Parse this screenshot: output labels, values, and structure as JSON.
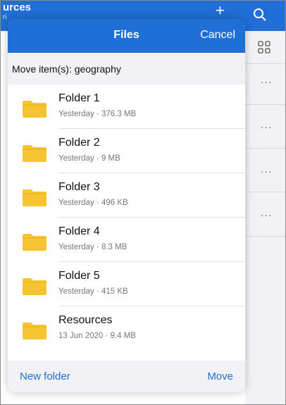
{
  "background": {
    "title": "urces",
    "subtitle": "ri",
    "plus_icon": "plus-icon",
    "search_icon": "search-icon",
    "grid_icon": "grid-view-icon",
    "more_icon": "more-icon",
    "more_label": "···"
  },
  "sheet": {
    "title": "Files",
    "cancel_label": "Cancel",
    "move_label_prefix": "Move item(s): ",
    "move_item_name": "geography",
    "items": [
      {
        "name": "Folder 1",
        "meta": "Yesterday · 376.3 MB"
      },
      {
        "name": "Folder 2",
        "meta": "Yesterday · 9 MB"
      },
      {
        "name": "Folder 3",
        "meta": "Yesterday · 496 KB"
      },
      {
        "name": "Folder 4",
        "meta": "Yesterday · 8.3 MB"
      },
      {
        "name": "Folder 5",
        "meta": "Yesterday · 415 KB"
      },
      {
        "name": "Resources",
        "meta": "13 Jun 2020 · 9.4 MB"
      }
    ],
    "new_folder_label": "New folder",
    "move_label": "Move"
  },
  "colors": {
    "accent": "#1f6fd6",
    "folder": "#f5c531",
    "folder_dark": "#e6ad12"
  }
}
